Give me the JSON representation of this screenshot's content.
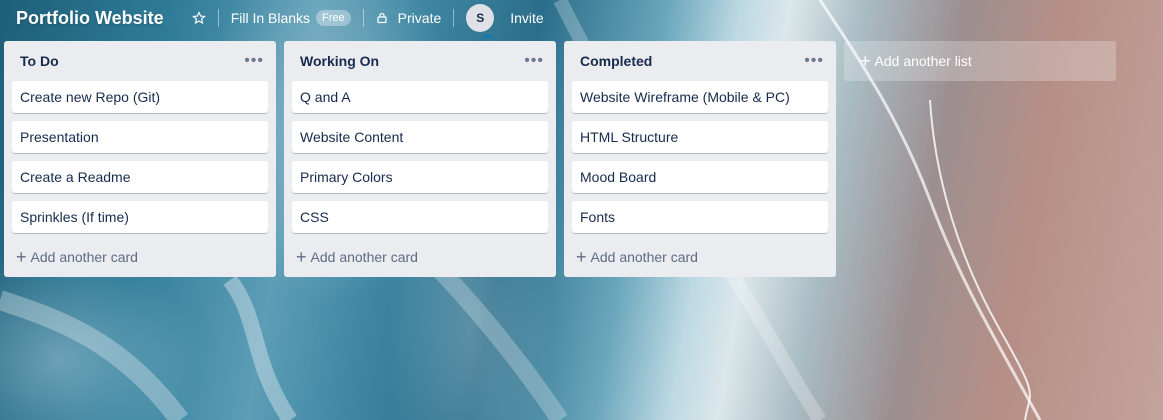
{
  "board": {
    "title": "Portfolio Website",
    "star_icon": "star-icon",
    "team_label": "Fill In Blanks",
    "team_badge": "Free",
    "visibility_icon": "lock-icon",
    "visibility_label": "Private",
    "member_initial": "S",
    "invite_label": "Invite"
  },
  "lists": [
    {
      "title": "To Do",
      "menu": "•••",
      "cards": [
        "Create new Repo (Git)",
        "Presentation",
        "Create a Readme",
        "Sprinkles (If time)"
      ],
      "add_card": "Add another card"
    },
    {
      "title": "Working On",
      "menu": "•••",
      "cards": [
        "Q and A",
        "Website Content",
        "Primary Colors",
        "CSS"
      ],
      "add_card": "Add another card"
    },
    {
      "title": "Completed",
      "menu": "•••",
      "cards": [
        "Website Wireframe (Mobile & PC)",
        "HTML Structure",
        "Mood Board",
        "Fonts"
      ],
      "add_card": "Add another card"
    }
  ],
  "add_list": "Add another list",
  "colors": {
    "list_bg": "#ebecf0",
    "card_text": "#172b4d",
    "muted_text": "#5e6c84"
  }
}
